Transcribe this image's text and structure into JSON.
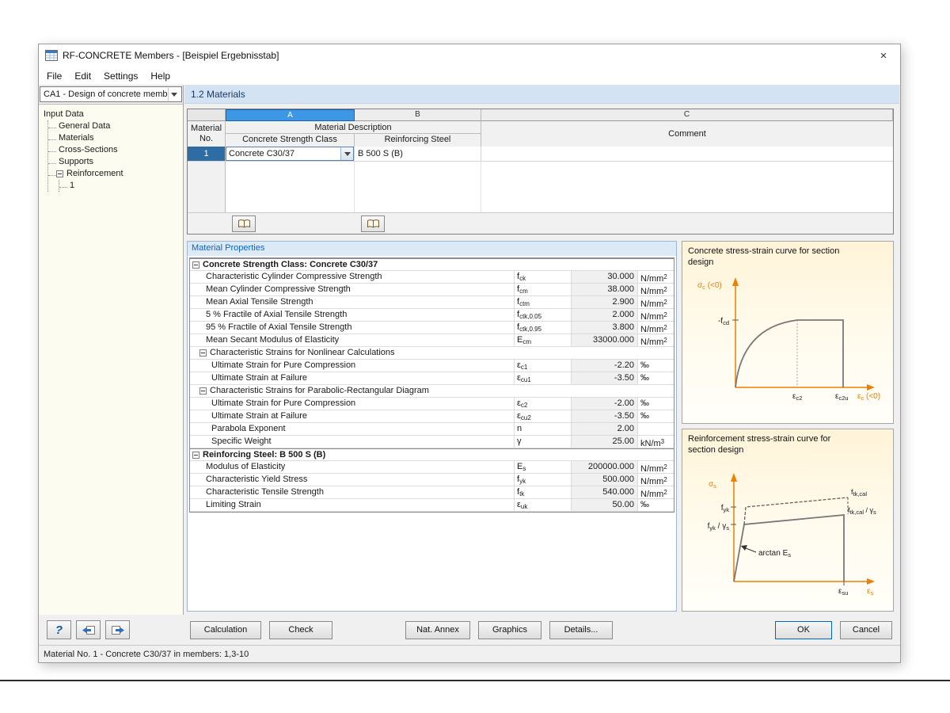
{
  "window": {
    "title": "RF-CONCRETE Members - [Beispiel Ergebnisstab]",
    "close_glyph": "×"
  },
  "menu": [
    "File",
    "Edit",
    "Settings",
    "Help"
  ],
  "sidebar": {
    "case_selector": "CA1 - Design of concrete memb",
    "tree": {
      "root": "Input Data",
      "items": [
        "General Data",
        "Materials",
        "Cross-Sections",
        "Supports",
        "Reinforcement"
      ],
      "reinforcement_child": "1"
    }
  },
  "section": {
    "title": "1.2 Materials"
  },
  "materials_table": {
    "columns": {
      "a": "A",
      "b": "B",
      "c": "C"
    },
    "header": {
      "material": "Material",
      "no": "No.",
      "description": "Material Description",
      "concrete": "Concrete Strength Class",
      "steel": "Reinforcing Steel",
      "comment": "Comment"
    },
    "row": {
      "no": "1",
      "concrete": "Concrete C30/37",
      "steel": "B 500 S (B)",
      "comment": ""
    }
  },
  "properties": {
    "title": "Material Properties",
    "rows": [
      {
        "type": "group",
        "label": "Concrete Strength Class: Concrete C30/37"
      },
      {
        "type": "item",
        "label": "Characteristic Cylinder Compressive Strength",
        "sym": "f",
        "sub": "ck",
        "value": "30.000",
        "unit": "N/mm",
        "usup": "2"
      },
      {
        "type": "item",
        "label": "Mean Cylinder Compressive Strength",
        "sym": "f",
        "sub": "cm",
        "value": "38.000",
        "unit": "N/mm",
        "usup": "2"
      },
      {
        "type": "item",
        "label": "Mean Axial Tensile Strength",
        "sym": "f",
        "sub": "ctm",
        "value": "2.900",
        "unit": "N/mm",
        "usup": "2"
      },
      {
        "type": "item",
        "label": "5 % Fractile of Axial Tensile Strength",
        "sym": "f",
        "sub": "ctk,0.05",
        "value": "2.000",
        "unit": "N/mm",
        "usup": "2"
      },
      {
        "type": "item",
        "label": "95 % Fractile of Axial Tensile Strength",
        "sym": "f",
        "sub": "ctk,0.95",
        "value": "3.800",
        "unit": "N/mm",
        "usup": "2"
      },
      {
        "type": "item",
        "label": "Mean Secant Modulus of Elasticity",
        "sym": "E",
        "sub": "cm",
        "value": "33000.000",
        "unit": "N/mm",
        "usup": "2"
      },
      {
        "type": "sub",
        "label": "Characteristic Strains for Nonlinear Calculations"
      },
      {
        "type": "item2",
        "label": "Ultimate Strain for Pure Compression",
        "sym": "ε",
        "sub": "c1",
        "value": "-2.20",
        "unit": "‰"
      },
      {
        "type": "item2",
        "label": "Ultimate Strain at Failure",
        "sym": "ε",
        "sub": "cu1",
        "value": "-3.50",
        "unit": "‰"
      },
      {
        "type": "sub",
        "label": "Characteristic Strains for Parabolic-Rectangular Diagram"
      },
      {
        "type": "item2",
        "label": "Ultimate Strain for Pure Compression",
        "sym": "ε",
        "sub": "c2",
        "value": "-2.00",
        "unit": "‰"
      },
      {
        "type": "item2",
        "label": "Ultimate Strain at Failure",
        "sym": "ε",
        "sub": "cu2",
        "value": "-3.50",
        "unit": "‰"
      },
      {
        "type": "item2",
        "label": "Parabola Exponent",
        "sym": "n",
        "sub": "",
        "value": "2.00",
        "unit": ""
      },
      {
        "type": "item2",
        "label": "Specific Weight",
        "sym": "γ",
        "sub": "",
        "value": "25.00",
        "unit": "kN/m",
        "usup": "3"
      },
      {
        "type": "group",
        "label": "Reinforcing Steel: B 500 S (B)"
      },
      {
        "type": "item",
        "label": "Modulus of Elasticity",
        "sym": "E",
        "sub": "s",
        "value": "200000.000",
        "unit": "N/mm",
        "usup": "2"
      },
      {
        "type": "item",
        "label": "Characteristic Yield Stress",
        "sym": "f",
        "sub": "yk",
        "value": "500.000",
        "unit": "N/mm",
        "usup": "2"
      },
      {
        "type": "item",
        "label": "Characteristic Tensile Strength",
        "sym": "f",
        "sub": "tk",
        "value": "540.000",
        "unit": "N/mm",
        "usup": "2"
      },
      {
        "type": "item",
        "label": "Limiting Strain",
        "sym": "ε",
        "sub": "uk",
        "value": "50.00",
        "unit": "‰"
      }
    ]
  },
  "diagrams": {
    "concrete": {
      "title": "Concrete stress-strain curve for section design",
      "labels": {
        "y_axis": {
          "base": "σ",
          "sub": "c",
          "rest": " (<0)"
        },
        "f_cd": {
          "base": "-f",
          "sub": "cd"
        },
        "eps_c2": {
          "base": "ε",
          "sub": "c2"
        },
        "eps_c2u": {
          "base": "ε",
          "sub": "c2u"
        },
        "x_axis": {
          "base": "ε",
          "sub": "c",
          "rest": " (<0)"
        }
      }
    },
    "steel": {
      "title": "Reinforcement stress-strain curve for section design",
      "labels": {
        "y_axis": {
          "base": "σ",
          "sub": "s"
        },
        "f_yk": {
          "base": "f",
          "sub": "yk"
        },
        "f_yk_gamma": {
          "base": "f",
          "sub": "yk",
          "rest": " / γ",
          "sub2": "s"
        },
        "f_tk_cal": {
          "base": "f",
          "sub": "tk,cal"
        },
        "f_tk_cal_gamma": {
          "base": "f",
          "sub": "tk,cal",
          "rest": " / γ",
          "sub2": "s"
        },
        "arctan": {
          "base": "arctan E",
          "sub": "s"
        },
        "eps_su": {
          "base": "ε",
          "sub": "su"
        },
        "x_axis": {
          "base": "ε",
          "sub": "s"
        }
      }
    }
  },
  "footer": {
    "calculation": "Calculation",
    "check": "Check",
    "nat_annex": "Nat. Annex",
    "graphics": "Graphics",
    "details": "Details...",
    "ok": "OK",
    "cancel": "Cancel"
  },
  "statusbar": {
    "text": "Material No. 1  -  Concrete C30/37 in members: 1,3-10"
  }
}
